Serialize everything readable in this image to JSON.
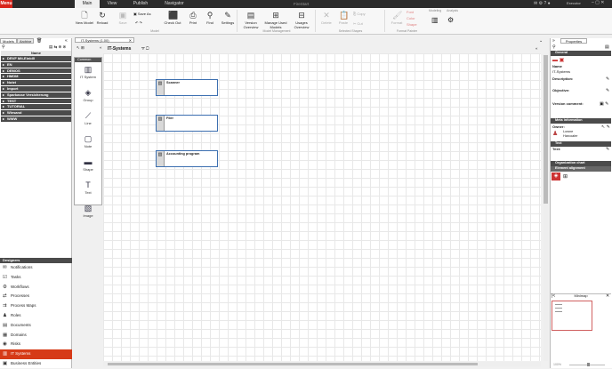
{
  "app": {
    "logo": "Menu",
    "window_title": "FireStart"
  },
  "menu": {
    "tabs": [
      "Main",
      "View",
      "Publish",
      "Navigator"
    ]
  },
  "ribbon": {
    "buttons": {
      "new_model": "New Model",
      "reload": "Reload",
      "save": "Save",
      "check_out": "Check Out",
      "print": "Print",
      "find": "Find",
      "settings": "Settings",
      "version_overview": "Version Overview",
      "manage_used_models": "Manage Used Models",
      "usages_overview": "Usages Overview",
      "delete": "Delete",
      "paste": "Paste",
      "format": "Format"
    },
    "small": {
      "save_as": "Save As",
      "copy": "Copy",
      "cut": "Cut",
      "font": "Font",
      "color": "Color",
      "shape": "Shape",
      "modeling": "Modeling",
      "analysis": "Analysis"
    },
    "groups": {
      "model": "Model",
      "model_management": "Model Management",
      "selected_shapes": "Selected Shapes",
      "format_painter": "Format Painter"
    }
  },
  "left": {
    "tabs": [
      "Models",
      "Archive"
    ],
    "column_header": "Name",
    "tree": [
      "DRVF Mit-Einbl0",
      "EN",
      "DEMOS",
      "HMDM",
      "Nutzt",
      "Import",
      "Sparkasse Versicherung",
      "TEST",
      "TUTORIAL",
      "Wiesand",
      "WWW"
    ],
    "designers_header": "Designers",
    "designers": [
      {
        "label": "Notifications",
        "icon": "bell-icon",
        "glyph": "✉"
      },
      {
        "label": "Tasks",
        "icon": "tasks-icon",
        "glyph": "☑"
      },
      {
        "label": "Workflows",
        "icon": "workflow-icon",
        "glyph": "⚙"
      },
      {
        "label": "Processes",
        "icon": "process-icon",
        "glyph": "⇄"
      },
      {
        "label": "Process Maps",
        "icon": "process-map-icon",
        "glyph": "⇉"
      },
      {
        "label": "Roles",
        "icon": "roles-icon",
        "glyph": "♟"
      },
      {
        "label": "Documents",
        "icon": "document-icon",
        "glyph": "▤"
      },
      {
        "label": "Domains",
        "icon": "domain-icon",
        "glyph": "▦"
      },
      {
        "label": "Risks",
        "icon": "risk-icon",
        "glyph": "◉"
      },
      {
        "label": "IT Systems",
        "icon": "it-system-icon",
        "glyph": "▥",
        "active": true
      },
      {
        "label": "Business Entities",
        "icon": "business-entity-icon",
        "glyph": "▣"
      }
    ]
  },
  "document": {
    "tab": "IT-Systems (1.00)",
    "title": "IT-Systems"
  },
  "palette": {
    "header": "Common",
    "items": [
      {
        "label": "IT System",
        "icon": "it-system-icon",
        "glyph": "▥"
      },
      {
        "label": "Group",
        "icon": "group-icon",
        "glyph": "◈"
      },
      {
        "label": "Line",
        "icon": "line-icon",
        "glyph": "⟋"
      },
      {
        "label": "Note",
        "icon": "note-icon",
        "glyph": "▢"
      },
      {
        "label": "Shape",
        "icon": "shape-icon",
        "glyph": "▬"
      },
      {
        "label": "Text",
        "icon": "text-icon",
        "glyph": "T"
      },
      {
        "label": "Image",
        "icon": "image-icon",
        "glyph": "▧"
      }
    ]
  },
  "canvas": {
    "objects": [
      "Scanner",
      "Filer",
      "Accounting program"
    ]
  },
  "properties": {
    "tab": "Properties",
    "general": "General",
    "name_label": "Name",
    "name_value": "IT-Systems",
    "description_label": "Description:",
    "objective_label": "Objective:",
    "version_comment_label": "Version comment:",
    "meta": "Meta information",
    "owner_label": "Owner:",
    "owner_value_1": "Lowne",
    "owner_value_2": "Harcoaler",
    "text_section": "Text",
    "text_label": "Text:",
    "org_chart": "Organization chart",
    "element_alignment": "Element alignment"
  },
  "minimap": {
    "title": "Minimap"
  },
  "zoom": {
    "value": "100%"
  }
}
